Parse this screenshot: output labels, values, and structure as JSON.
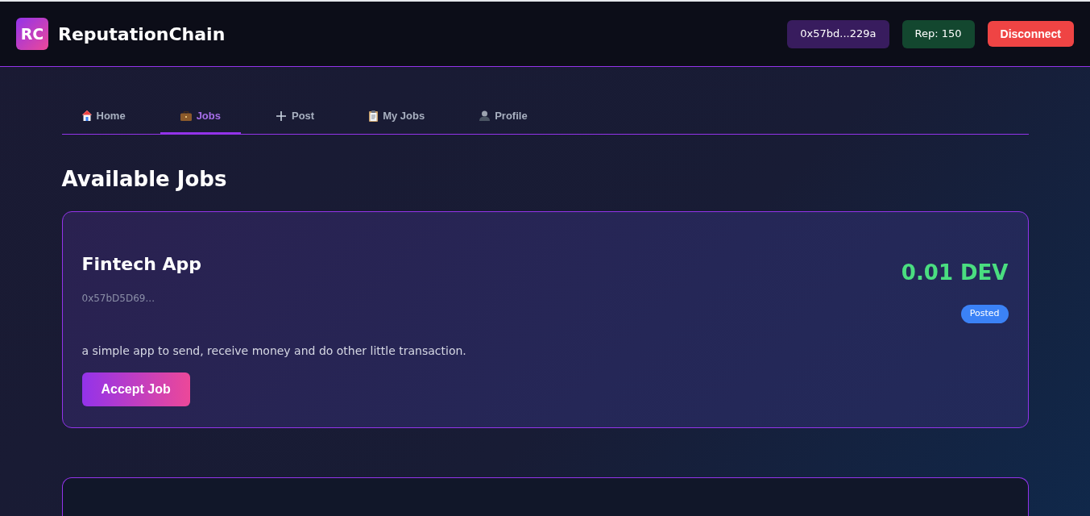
{
  "header": {
    "logo": "RC",
    "title": "ReputationChain",
    "address": "0x57bd...229a",
    "reputation": "Rep: 150",
    "disconnect": "Disconnect"
  },
  "tabs": [
    {
      "label": "Home",
      "kind": "home",
      "selected": false
    },
    {
      "label": "Jobs",
      "kind": "jobs",
      "selected": true
    },
    {
      "label": "Post",
      "kind": "post",
      "selected": false
    },
    {
      "label": "My Jobs",
      "kind": "myjobs",
      "selected": false
    },
    {
      "label": "Profile",
      "kind": "profile",
      "selected": false
    }
  ],
  "heading": "Available Jobs",
  "jobs": [
    {
      "title": "Fintech App",
      "poster": "0x57bD5D69...",
      "reward": "0.01 DEV",
      "status": "Posted",
      "description": "a simple app to send, receive money and do other little transaction.",
      "action": "Accept Job"
    }
  ],
  "lower_card": {
    "kind": "panel"
  }
}
